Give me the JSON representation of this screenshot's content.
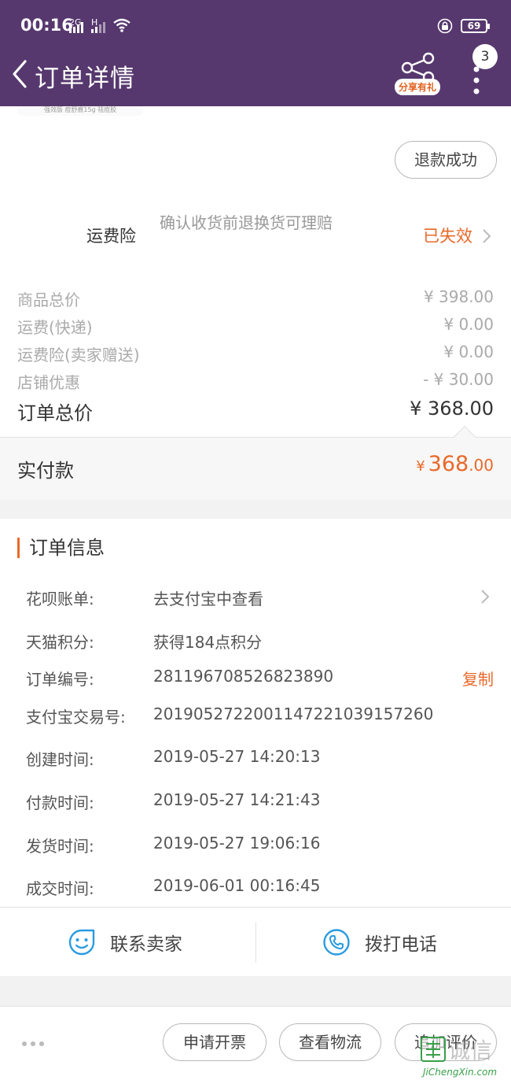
{
  "status_bar": {
    "time": "00:16",
    "sim1": "2G",
    "sim2": "H",
    "battery": "69"
  },
  "nav": {
    "title": "订单详情",
    "share_label": "分享有礼",
    "badge_count": "3"
  },
  "product_thumb_caption": "强效版 痘舒痕15g 祛痘胶",
  "refund_status": "退款成功",
  "shipping_insurance": {
    "label": "运费险",
    "description": "确认收货前退换货可理赔",
    "status": "已失效"
  },
  "price_breakdown": [
    {
      "label": "商品总价",
      "value": "¥ 398.00"
    },
    {
      "label": "运费(快递)",
      "value": "¥ 0.00"
    },
    {
      "label": "运费险(卖家赠送)",
      "value": "¥ 0.00"
    },
    {
      "label": "店铺优惠",
      "value": "- ¥ 30.00"
    }
  ],
  "order_total": {
    "label": "订单总价",
    "value": "¥ 368.00"
  },
  "paid": {
    "label": "实付款",
    "currency": "¥",
    "integer": "368",
    "cents": ".00"
  },
  "order_info": {
    "title": "订单信息",
    "rows": [
      {
        "key": "花呗账单:",
        "value": "去支付宝中查看"
      },
      {
        "key": "天猫积分:",
        "value": "获得184点积分"
      },
      {
        "key": "订单编号:",
        "value": "281196708526823890",
        "action": "复制"
      },
      {
        "key": "支付宝交易号:",
        "value": "2019052722001147221039157260"
      },
      {
        "key": "创建时间:",
        "value": "2019-05-27 14:20:13"
      },
      {
        "key": "付款时间:",
        "value": "2019-05-27 14:21:43"
      },
      {
        "key": "发货时间:",
        "value": "2019-05-27 19:06:16"
      },
      {
        "key": "成交时间:",
        "value": "2019-06-01 00:16:45"
      }
    ]
  },
  "contact": {
    "seller": "联系卖家",
    "phone": "拨打电话"
  },
  "bottom_actions": {
    "invoice": "申请开票",
    "logistics": "查看物流",
    "review": "追加评价"
  },
  "watermark": {
    "main": "诚信",
    "sub": "JiChengXin.com"
  },
  "colors": {
    "header": "#56386e",
    "accent": "#e8692a",
    "contact_icon": "#2a9be0"
  }
}
